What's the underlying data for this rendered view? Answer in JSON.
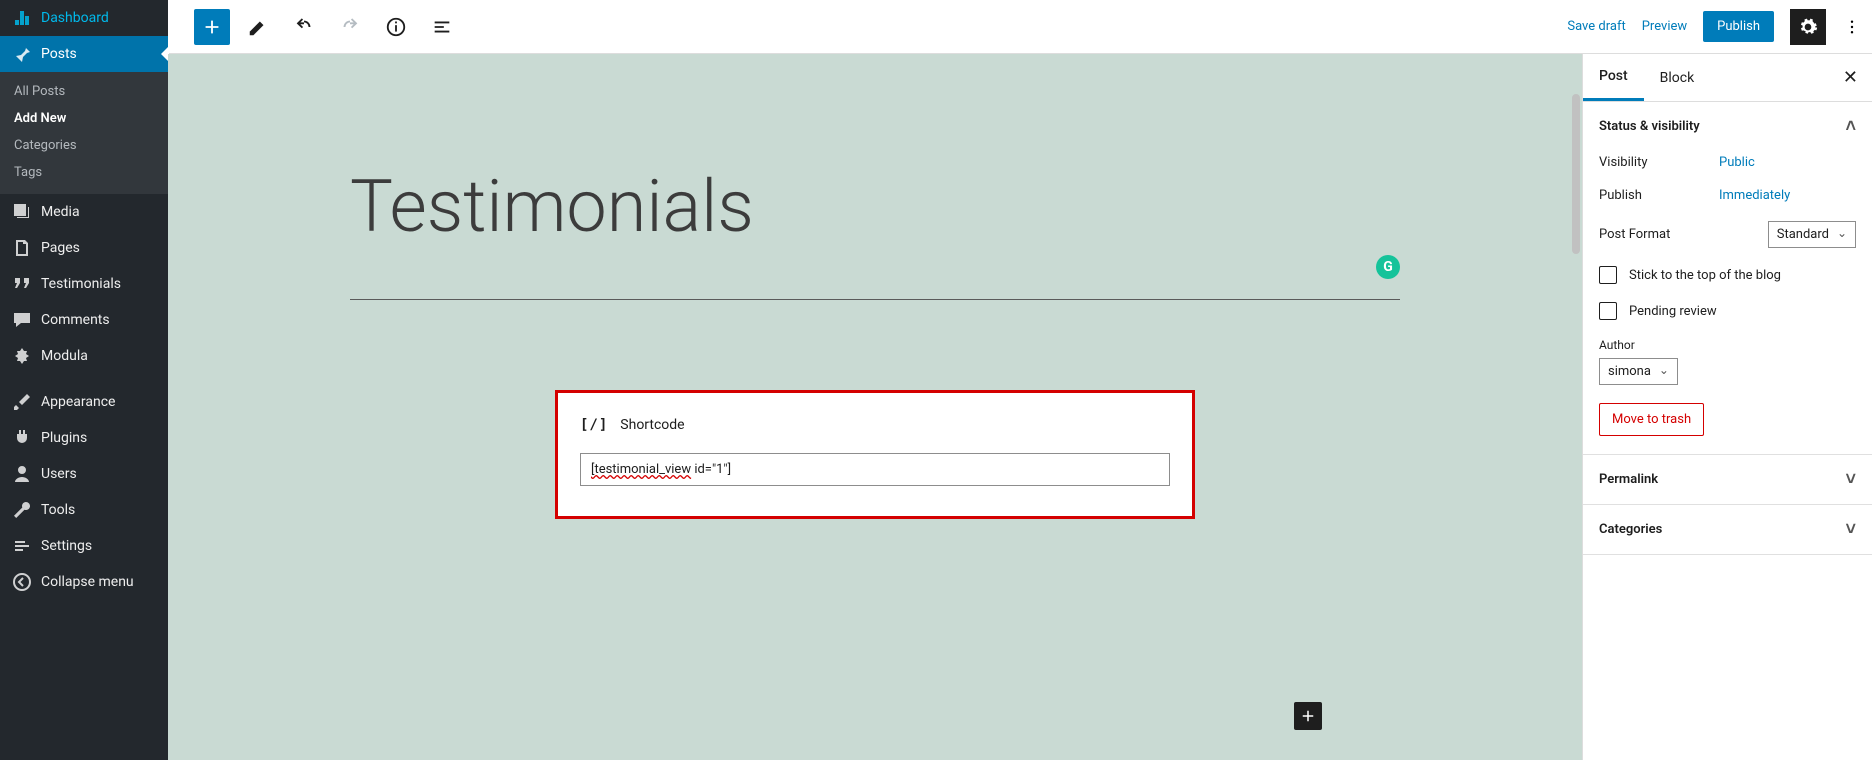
{
  "sidebar": {
    "dashboard": "Dashboard",
    "posts": "Posts",
    "posts_sub": {
      "all": "All Posts",
      "add": "Add New",
      "cats": "Categories",
      "tags": "Tags"
    },
    "media": "Media",
    "pages": "Pages",
    "testimonials": "Testimonials",
    "comments": "Comments",
    "modula": "Modula",
    "appearance": "Appearance",
    "plugins": "Plugins",
    "users": "Users",
    "tools": "Tools",
    "settings": "Settings",
    "collapse": "Collapse menu"
  },
  "topbar": {
    "save_draft": "Save draft",
    "preview": "Preview",
    "publish": "Publish"
  },
  "editor": {
    "title": "Testimonials",
    "shortcode_label": "Shortcode",
    "shortcode_value_prefix": "[testimonial_view",
    "shortcode_value_suffix": " id=\"1\"]"
  },
  "panel": {
    "tab_post": "Post",
    "tab_block": "Block",
    "status_section": "Status & visibility",
    "visibility_label": "Visibility",
    "visibility_value": "Public",
    "publish_label": "Publish",
    "publish_value": "Immediately",
    "post_format_label": "Post Format",
    "post_format_value": "Standard",
    "stick_label": "Stick to the top of the blog",
    "pending_label": "Pending review",
    "author_label": "Author",
    "author_value": "simona",
    "trash": "Move to trash",
    "permalink": "Permalink",
    "categories": "Categories"
  }
}
